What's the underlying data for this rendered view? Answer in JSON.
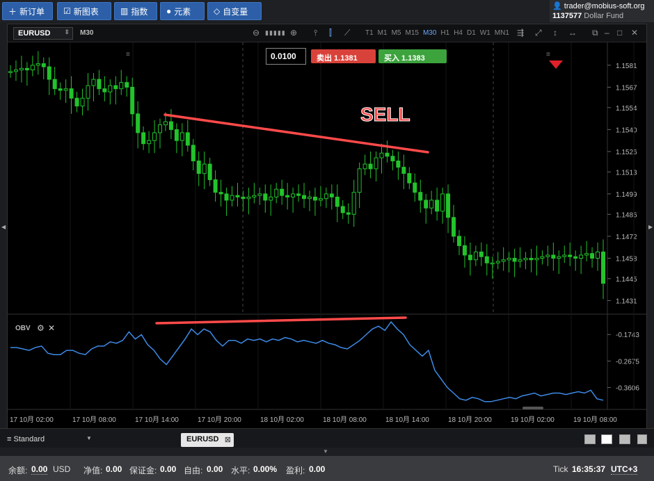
{
  "toolbar": {
    "new_order": "新订单",
    "new_chart": "新图表",
    "indicators": "指数",
    "elements": "元素",
    "variables": "自变量"
  },
  "account": {
    "user": "trader@mobius-soft.org",
    "number": "1137577",
    "fund": "Dollar Fund"
  },
  "chart": {
    "symbol": "EURUSD",
    "timeframe": "M30",
    "timeframes": [
      "T1",
      "M1",
      "M5",
      "M15",
      "M30",
      "H1",
      "H4",
      "D1",
      "W1",
      "MN1"
    ],
    "active_timeframe": "M30",
    "lot": "0.0100",
    "sell_label": "卖出 1.1381",
    "buy_label": "买入 1.1383",
    "annotation": "SELL",
    "price_axis": [
      "1.1581",
      "1.1567",
      "1.1554",
      "1.1540",
      "1.1526",
      "1.1513",
      "1.1499",
      "1.1486",
      "1.1472",
      "1.1458",
      "1.1445",
      "1.1431"
    ],
    "indicator_name": "OBV",
    "obv_axis": [
      "-0.1743",
      "-0.2675",
      "-0.3606"
    ],
    "time_axis": [
      "17 10月 02:00",
      "17 10月 08:00",
      "17 10月 14:00",
      "17 10月 20:00",
      "18 10月 02:00",
      "18 10月 08:00",
      "18 10月 14:00",
      "18 10月 20:00",
      "19 10月 02:00",
      "19 10月 08:00"
    ],
    "colors": {
      "up": "#22c32b",
      "down": "#22c32b",
      "obv": "#3d8be8",
      "trend": "#ff4a4a",
      "sell": "#d9423a",
      "buy": "#3da33d"
    }
  },
  "panel": {
    "layout_name": "Standard",
    "tab": "EURUSD"
  },
  "status": {
    "balance_label": "余额:",
    "balance_value": "0.00",
    "currency": "USD",
    "equity_label": "净值:",
    "equity_value": "0.00",
    "margin_label": "保证金:",
    "margin_value": "0.00",
    "free_label": "自由:",
    "free_value": "0.00",
    "level_label": "水平:",
    "level_value": "0.00%",
    "profit_label": "盈利:",
    "profit_value": "0.00",
    "tick_label": "Tick",
    "time": "16:35:37",
    "tz": "UTC+3"
  },
  "chart_data": {
    "type": "candlestick",
    "symbol": "EURUSD",
    "timeframe": "M30",
    "ylim": [
      1.1425,
      1.1592
    ],
    "close_series": [
      1.1577,
      1.1578,
      1.1579,
      1.1578,
      1.1581,
      1.1582,
      1.158,
      1.1572,
      1.1566,
      1.1565,
      1.1566,
      1.156,
      1.1555,
      1.156,
      1.1568,
      1.1572,
      1.1566,
      1.1564,
      1.1568,
      1.1566,
      1.157,
      1.1567,
      1.155,
      1.1538,
      1.1531,
      1.1533,
      1.1538,
      1.1543,
      1.1545,
      1.154,
      1.1533,
      1.1538,
      1.153,
      1.152,
      1.1512,
      1.1518,
      1.1508,
      1.15,
      1.1499,
      1.1495,
      1.1498,
      1.1497,
      1.1496,
      1.1497,
      1.1498,
      1.1499,
      1.1495,
      1.1497,
      1.1502,
      1.1498,
      1.1497,
      1.1499,
      1.1498,
      1.1496,
      1.1497,
      1.1495,
      1.1496,
      1.1499,
      1.1497,
      1.1491,
      1.1487,
      1.1486,
      1.15,
      1.1515,
      1.1518,
      1.1515,
      1.1522,
      1.1525,
      1.1523,
      1.152,
      1.1516,
      1.1512,
      1.1506,
      1.15,
      1.1495,
      1.149,
      1.1495,
      1.1488,
      1.1499,
      1.1484,
      1.1472,
      1.1466,
      1.146,
      1.1457,
      1.1462,
      1.1459,
      1.1455,
      1.1455,
      1.1456,
      1.1457,
      1.1458,
      1.1456,
      1.1457,
      1.1458,
      1.1457,
      1.1458,
      1.1459,
      1.146,
      1.1458,
      1.1459,
      1.146,
      1.1459,
      1.1458,
      1.146,
      1.1461,
      1.1458,
      1.1462,
      1.1442
    ],
    "obv_series": [
      -0.22,
      -0.22,
      -0.225,
      -0.23,
      -0.22,
      -0.215,
      -0.24,
      -0.245,
      -0.245,
      -0.23,
      -0.23,
      -0.24,
      -0.245,
      -0.225,
      -0.215,
      -0.215,
      -0.2,
      -0.205,
      -0.195,
      -0.165,
      -0.19,
      -0.175,
      -0.21,
      -0.23,
      -0.26,
      -0.28,
      -0.25,
      -0.22,
      -0.19,
      -0.155,
      -0.175,
      -0.155,
      -0.165,
      -0.195,
      -0.215,
      -0.195,
      -0.195,
      -0.205,
      -0.19,
      -0.195,
      -0.19,
      -0.2,
      -0.19,
      -0.195,
      -0.185,
      -0.19,
      -0.2,
      -0.195,
      -0.2,
      -0.205,
      -0.195,
      -0.205,
      -0.21,
      -0.22,
      -0.225,
      -0.21,
      -0.195,
      -0.175,
      -0.155,
      -0.145,
      -0.16,
      -0.13,
      -0.155,
      -0.175,
      -0.21,
      -0.23,
      -0.25,
      -0.23,
      -0.3,
      -0.33,
      -0.36,
      -0.38,
      -0.4,
      -0.405,
      -0.395,
      -0.4,
      -0.41,
      -0.41,
      -0.405,
      -0.4,
      -0.395,
      -0.4,
      -0.39,
      -0.385,
      -0.38,
      -0.39,
      -0.385,
      -0.38,
      -0.38,
      -0.385,
      -0.38,
      -0.375,
      -0.38,
      -0.37,
      -0.4,
      -0.405
    ]
  }
}
